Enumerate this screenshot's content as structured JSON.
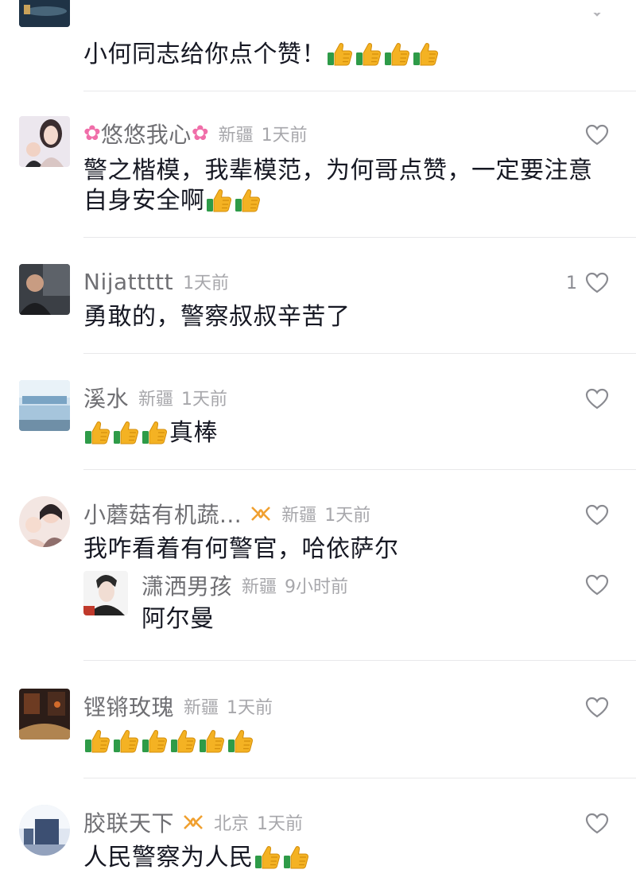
{
  "colors": {
    "username": "#6f6f73",
    "meta": "#a7a7ab",
    "text": "#161823",
    "badge": "#f0a030",
    "divider": "#e8e8ea"
  },
  "comments": [
    {
      "text_before": "小何同志给你点个赞！",
      "thumbs": 4,
      "text_after": ""
    },
    {
      "username": "悠悠我心",
      "region": "新疆",
      "time": "1天前",
      "text_before": "警之楷模，我辈模范，为何哥点赞，一定要注意自身安全啊",
      "thumbs": 2,
      "text_after": ""
    },
    {
      "username": "Nijattttt",
      "time": "1天前",
      "likes": "1",
      "text_before": "勇敢的，警察叔叔辛苦了",
      "thumbs": 0,
      "text_after": ""
    },
    {
      "username": "溪水",
      "region": "新疆",
      "time": "1天前",
      "text_before": "",
      "thumbs": 3,
      "text_after": "真棒"
    },
    {
      "username": "小蘑菇有机蔬...",
      "region": "新疆",
      "time": "1天前",
      "text_before": "我咋看着有何警官，哈依萨尔",
      "thumbs": 0,
      "text_after": "",
      "reply": {
        "username": "潇洒男孩",
        "region": "新疆",
        "time": "9小时前",
        "text": "阿尔曼"
      }
    },
    {
      "username": "铿锵玫瑰",
      "region": "新疆",
      "time": "1天前",
      "text_before": "",
      "thumbs": 6,
      "text_after": ""
    },
    {
      "username": "胶联天下",
      "region": "北京",
      "time": "1天前",
      "text_before": "人民警察为人民",
      "thumbs": 2,
      "text_after": ""
    }
  ],
  "icons": {
    "like": "heart-outline-icon",
    "thumb": "thumbs-up-emoji",
    "badge": "infinity-badge-icon",
    "flower": "cherry-blossom-emoji"
  }
}
